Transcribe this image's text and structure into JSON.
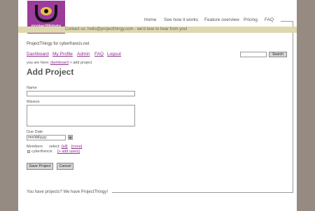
{
  "logo": {
    "text": "projectthingy",
    "mark_color": "#9b3c9a"
  },
  "topnav": {
    "items": [
      "Home",
      "See how it works",
      "Feature overview",
      "Pricing",
      "FAQ"
    ]
  },
  "contact": {
    "text": "Contact us: hello@projectthingy.com - we'd love to hear from you!"
  },
  "site": {
    "title": "ProjectThingy for cyberfrancis.net"
  },
  "usernav": {
    "items": [
      "Dashboard",
      "My Profile",
      "Admin",
      "FAQ",
      "Logout"
    ]
  },
  "search": {
    "button_label": "Search",
    "value": ""
  },
  "breadcrumb": {
    "prefix": "you are here:",
    "link": "dashboard",
    "sep": ">",
    "current": "add project"
  },
  "page": {
    "title": "Add Project"
  },
  "form": {
    "name_label": "Name",
    "name_value": "",
    "mission_label": "Mission",
    "mission_value": "",
    "due_label": "Due Date",
    "due_value": "mm/dd/yyyy",
    "calendar_icon": "calendar-icon",
    "members_label": "Members",
    "select_label": "select:",
    "all_link": "[all]",
    "none_link": "[none]",
    "member_name": "cyberfrancis",
    "member_checked": true,
    "add_users_link": "[+ add users]",
    "save_label": "Save Project",
    "cancel_label": "Cancel"
  },
  "footer": {
    "text": "You have projects? We have ProjectThingy!"
  },
  "colors": {
    "accent": "#8d2d8d",
    "logo": "#9b3c9a",
    "contact_bar": "#ddd9ad",
    "background": "#958b82"
  }
}
